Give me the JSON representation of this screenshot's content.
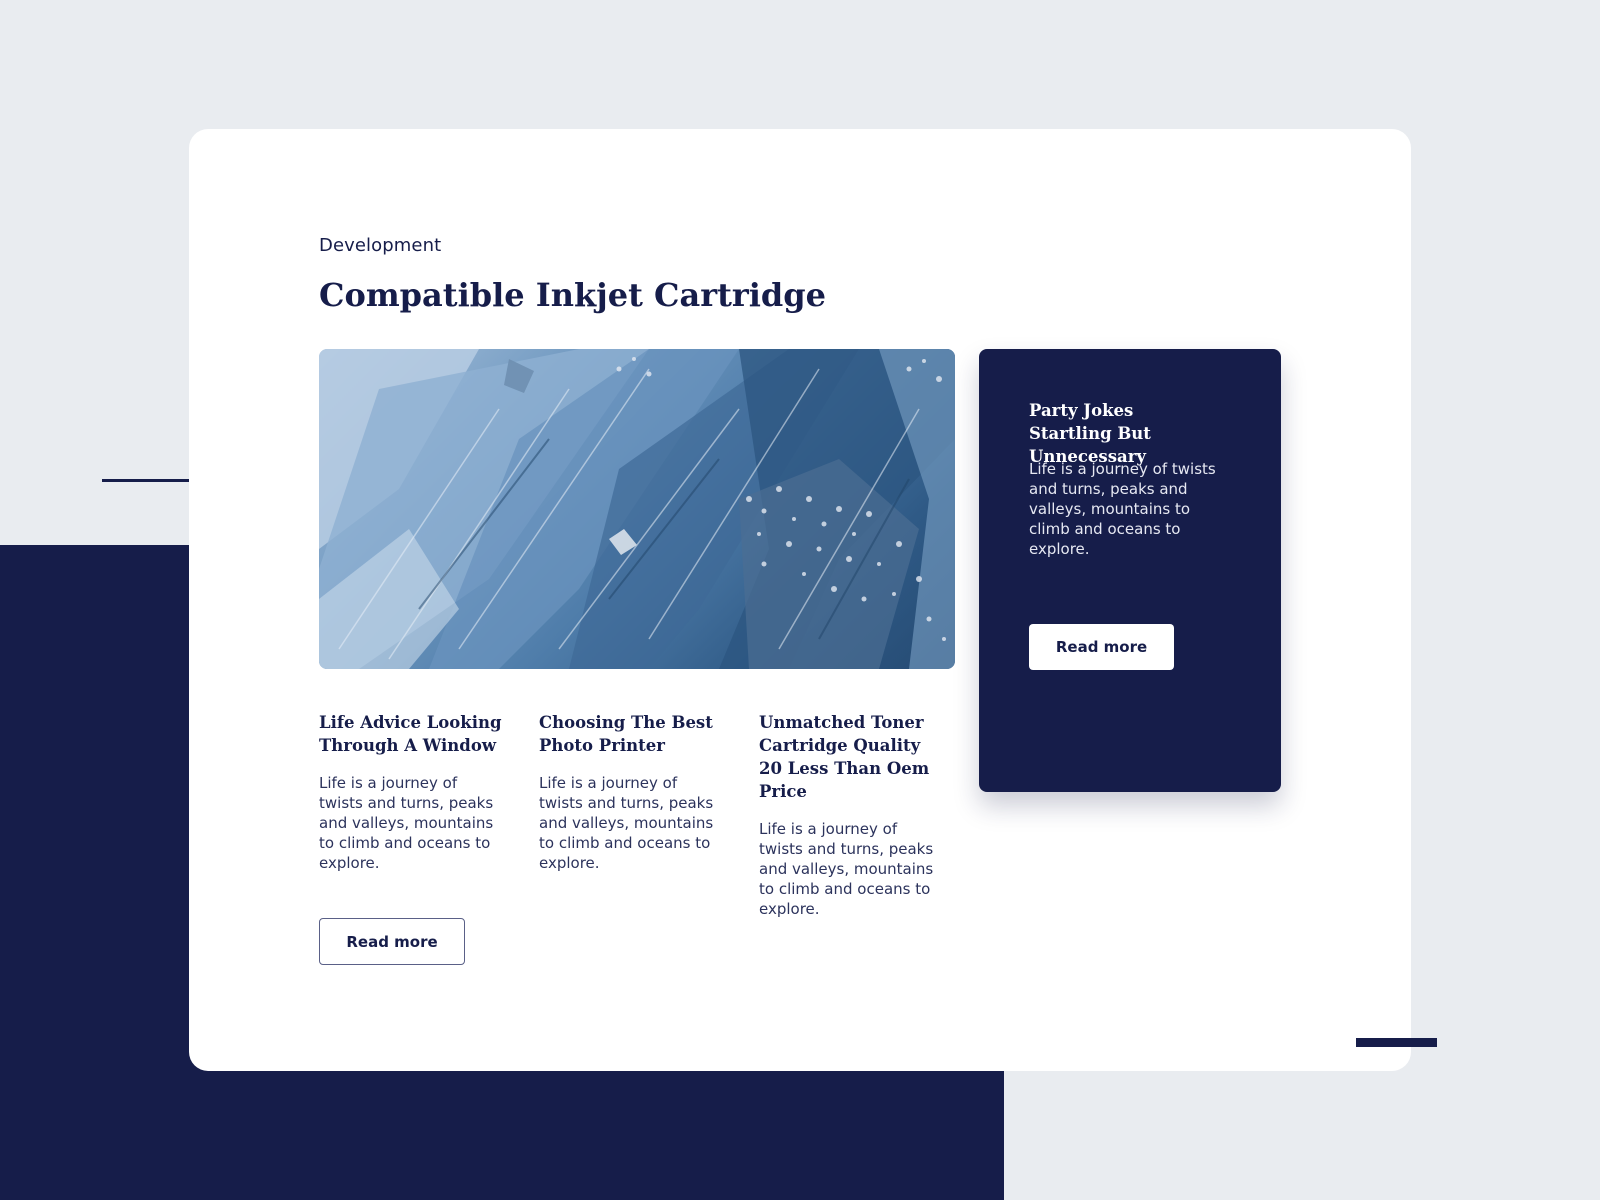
{
  "section": {
    "category": "Development",
    "title": "Compatible Inkjet Cartridge"
  },
  "hero": {
    "image": "blue-rock-texture-photo"
  },
  "articles": [
    {
      "title": "Life Advice Looking Through A Window",
      "excerpt": "Life is a journey of twists and turns, peaks and valleys, mountains to climb and oceans to explore."
    },
    {
      "title": "Choosing The Best Photo Printer",
      "excerpt": "Life is a journey of twists and turns, peaks and valleys, mountains to climb and oceans to explore."
    },
    {
      "title": "Unmatched Toner Cartridge Quality 20 Less Than Oem Price",
      "excerpt": "Life is a journey of twists and turns, peaks and valleys, mountains to climb and oceans to explore."
    }
  ],
  "main_button": {
    "label": "Read more"
  },
  "featured": {
    "title": "Party Jokes Startling But Unnecessary",
    "excerpt": "Life is a journey of twists and turns, peaks and valleys, mountains to climb and oceans to explore.",
    "button_label": "Read more"
  },
  "colors": {
    "navy": "#161d4a",
    "page_background": "#e9ecf0",
    "card_background": "#ffffff"
  }
}
